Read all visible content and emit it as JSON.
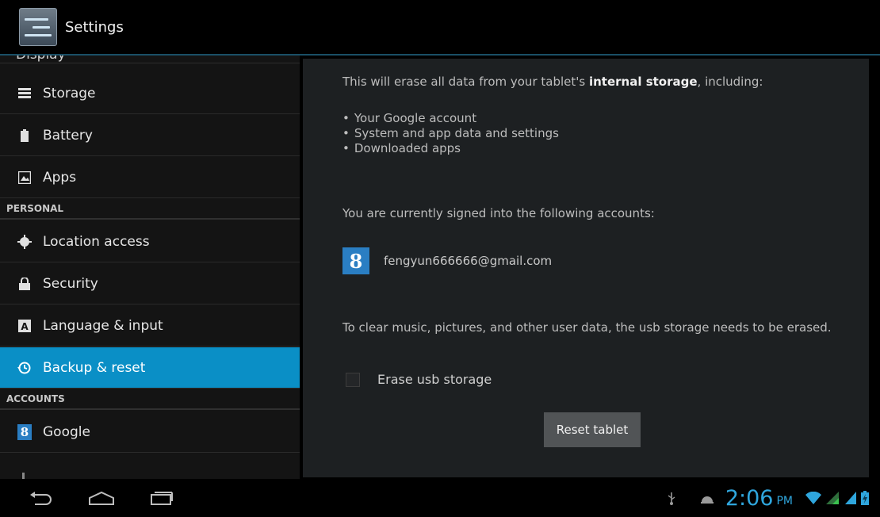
{
  "app": {
    "title": "Settings"
  },
  "sidebar": {
    "cut_item": "Display",
    "items": [
      {
        "label": "Storage",
        "icon": "storage-icon"
      },
      {
        "label": "Battery",
        "icon": "battery-icon"
      },
      {
        "label": "Apps",
        "icon": "apps-icon"
      }
    ],
    "personal_header": "PERSONAL",
    "personal_items": [
      {
        "label": "Location access",
        "icon": "location-icon"
      },
      {
        "label": "Security",
        "icon": "lock-icon"
      },
      {
        "label": "Language & input",
        "icon": "keyboard-icon"
      },
      {
        "label": "Backup & reset",
        "icon": "backup-icon",
        "active": true
      }
    ],
    "accounts_header": "ACCOUNTS",
    "account_items": [
      {
        "label": "Google",
        "icon": "google-icon"
      }
    ]
  },
  "main": {
    "intro_prefix": "This will erase all data from your tablet's ",
    "intro_bold": "internal storage",
    "intro_suffix": ", including:",
    "bullets": [
      "Your Google account",
      "System and app data and settings",
      "Downloaded apps"
    ],
    "signed_in_text": "You are currently signed into the following accounts:",
    "account_glyph": "8",
    "account_email": "fengyun666666@gmail.com",
    "clear_text": "To clear music, pictures, and other user data, the usb storage needs to be erased.",
    "erase_label": "Erase usb storage",
    "erase_checked": false,
    "reset_button": "Reset tablet"
  },
  "statusbar": {
    "time": "2:06",
    "ampm": "PM"
  },
  "colors": {
    "accent": "#0a8fc6",
    "clock": "#2fa6dd"
  }
}
